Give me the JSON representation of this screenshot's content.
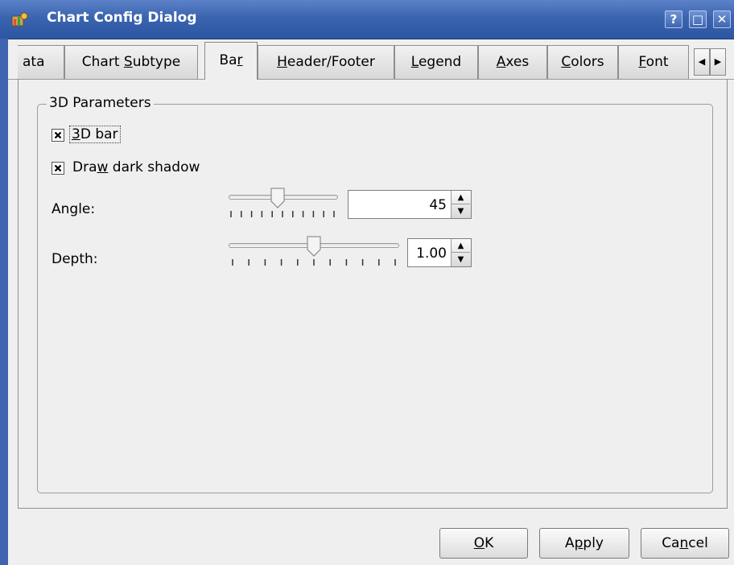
{
  "window": {
    "title": "Chart Config Dialog",
    "help_label": "?",
    "maximize_label": "□",
    "close_label": "✕"
  },
  "tabs": [
    {
      "label": "ata"
    },
    {
      "pre": "Chart ",
      "mnemonic": "S",
      "post": "ubtype"
    },
    {
      "pre": "Ba",
      "mnemonic": "r",
      "post": ""
    },
    {
      "pre": "",
      "mnemonic": "H",
      "post": "eader/Footer"
    },
    {
      "pre": "",
      "mnemonic": "L",
      "post": "egend"
    },
    {
      "pre": "",
      "mnemonic": "A",
      "post": "xes"
    },
    {
      "pre": "",
      "mnemonic": "C",
      "post": "olors"
    },
    {
      "pre": "",
      "mnemonic": "F",
      "post": "ont"
    }
  ],
  "active_tab": "Bar",
  "tab_scroll": {
    "left": "◀",
    "right": "▶"
  },
  "group": {
    "title": "3D Parameters",
    "bar3d": {
      "pre": "",
      "mnemonic": "3",
      "post": "D bar",
      "checked": true
    },
    "dark_shadow": {
      "pre": "Dra",
      "mnemonic": "w",
      "post": " dark shadow",
      "checked": true
    },
    "angle": {
      "label": "Angle:",
      "value": "45",
      "slider_fraction": 0.45
    },
    "depth": {
      "label": "Depth:",
      "value": "1.00",
      "slider_fraction": 0.5
    }
  },
  "buttons": {
    "ok": {
      "pre": "",
      "mnemonic": "O",
      "post": "K"
    },
    "apply": {
      "pre": "A",
      "mnemonic": "p",
      "post": "ply"
    },
    "cancel": {
      "pre": "Ca",
      "mnemonic": "n",
      "post": "cel"
    }
  },
  "colors": {
    "titlebar": "#3b64b0",
    "background": "#efefef"
  }
}
